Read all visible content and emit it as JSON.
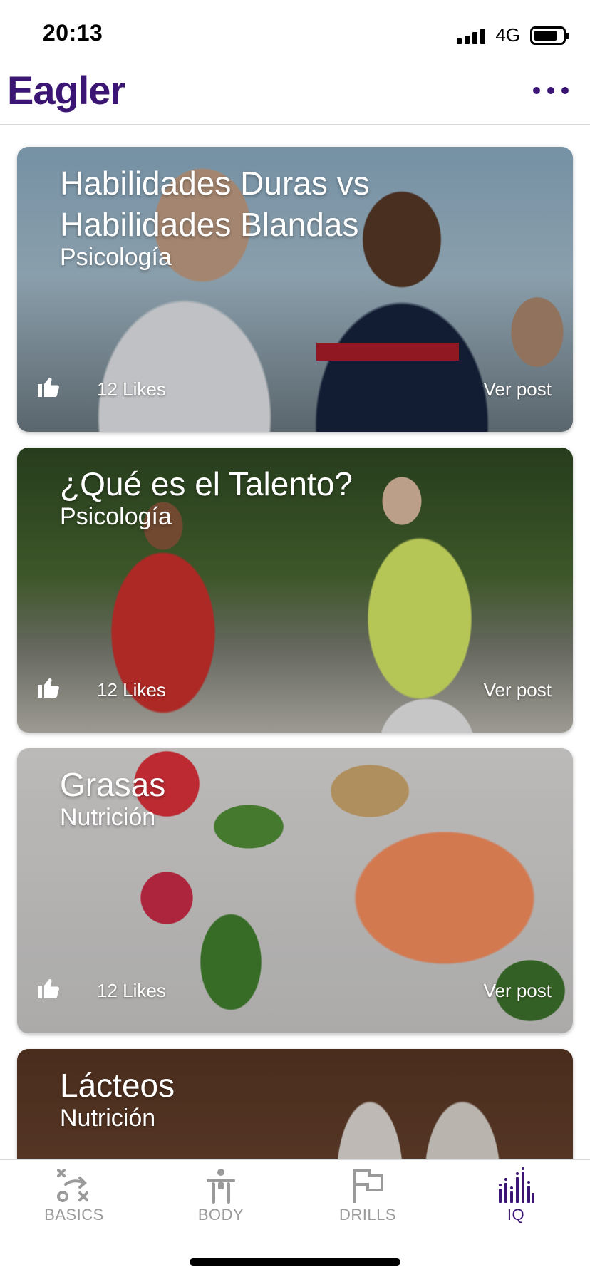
{
  "status_bar": {
    "time": "20:13",
    "network": "4G"
  },
  "header": {
    "logo": "Eagler",
    "menu_icon": "more-horizontal-icon",
    "brand_color": "#3b1573"
  },
  "feed": {
    "cards": [
      {
        "title": "Habilidades Duras vs Habilidades Blandas",
        "category": "Psicología",
        "likes": "12 Likes",
        "link": "Ver post",
        "like_icon": "thumbs-up-icon"
      },
      {
        "title": "¿Qué es el Talento?",
        "category": "Psicología",
        "likes": "12 Likes",
        "link": "Ver post",
        "like_icon": "thumbs-up-icon"
      },
      {
        "title": "Grasas",
        "category": "Nutrición",
        "likes": "12 Likes",
        "link": "Ver post",
        "like_icon": "thumbs-up-icon"
      },
      {
        "title": "Lácteos",
        "category": "Nutrición"
      }
    ]
  },
  "tab_bar": {
    "tabs": [
      {
        "label": "BASICS",
        "icon": "strategy-icon",
        "active": false
      },
      {
        "label": "BODY",
        "icon": "body-icon",
        "active": false
      },
      {
        "label": "DRILLS",
        "icon": "flag-icon",
        "active": false
      },
      {
        "label": "IQ",
        "icon": "bars-icon",
        "active": true
      }
    ],
    "inactive_color": "#9a9a9a",
    "active_color": "#3b1573"
  }
}
